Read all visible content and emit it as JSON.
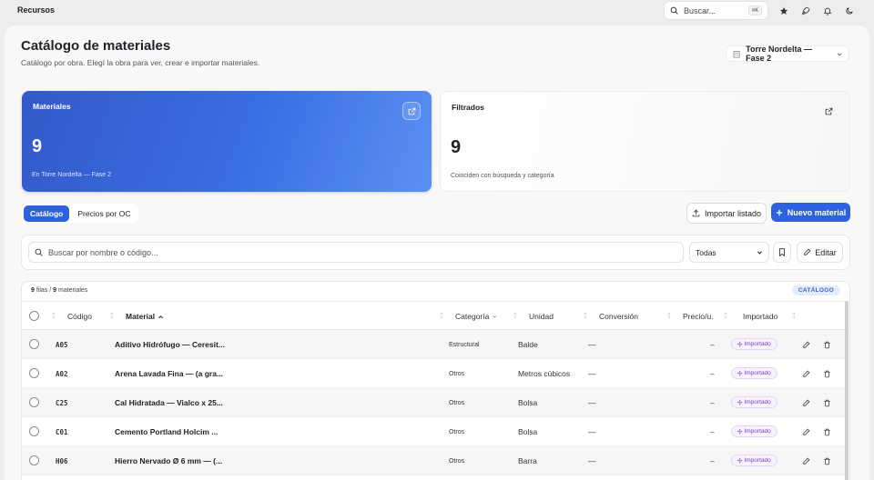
{
  "topbar": {
    "brand": "Recursos",
    "search_placeholder": "Buscar...",
    "search_shortcut": "⌘K",
    "icons": [
      "star-icon",
      "rocket-icon",
      "bell-icon",
      "moon-icon"
    ]
  },
  "header": {
    "title": "Catálogo de materiales",
    "subtitle": "Catálogo por obra. Elegí la obra para ver, crear e importar materiales.",
    "obra_selected": "Torre Nordelta — Fase 2"
  },
  "cards": {
    "materiales": {
      "title": "Materiales",
      "value": "9",
      "footer": "En Torre Nordelta — Fase 2"
    },
    "filtrados": {
      "title": "Filtrados",
      "value": "9",
      "footer": "Coinciden con búsqueda y categoría"
    }
  },
  "tabs": [
    {
      "label": "Catálogo",
      "active": true
    },
    {
      "label": "Precios por OC",
      "active": false
    }
  ],
  "actions": {
    "import_label": "Importar listado",
    "new_label": "Nuevo material"
  },
  "filters": {
    "search_placeholder": "Buscar por nombre o código...",
    "category_selected": "Todas",
    "edit_label": "Editar"
  },
  "table": {
    "meta_rows": "9",
    "meta_rows_label": "filas /",
    "meta_total": "9",
    "meta_total_label": "materiales",
    "badge": "CATÁLOGO",
    "columns": {
      "codigo": "Código",
      "material": "Material",
      "categoria": "Categoría",
      "unidad": "Unidad",
      "conversion": "Conversión",
      "precio": "Precio/u.",
      "importado": "Importado"
    },
    "rows": [
      {
        "codigo": "A05",
        "material": "Aditivo Hidrófugo — Ceresit...",
        "categoria": "Estructural",
        "unidad": "Balde",
        "conversion": "—",
        "precio": "–",
        "importado": "Importado"
      },
      {
        "codigo": "A02",
        "material": "Arena Lavada Fina — (a gra...",
        "categoria": "Otros",
        "unidad": "Metros cúbicos",
        "conversion": "—",
        "precio": "–",
        "importado": "Importado"
      },
      {
        "codigo": "C25",
        "material": "Cal Hidratada — Vialco x 25...",
        "categoria": "Otros",
        "unidad": "Bolsa",
        "conversion": "—",
        "precio": "–",
        "importado": "Importado"
      },
      {
        "codigo": "C01",
        "material": "Cemento Portland Holcim ...",
        "categoria": "Otros",
        "unidad": "Bolsa",
        "conversion": "—",
        "precio": "–",
        "importado": "Importado"
      },
      {
        "codigo": "H06",
        "material": "Hierro Nervado Ø 6 mm — (...",
        "categoria": "Otros",
        "unidad": "Barra",
        "conversion": "—",
        "precio": "–",
        "importado": "Importado"
      }
    ]
  },
  "colors": {
    "accent": "#2c62e0",
    "card_gradient_start": "#3459c8",
    "card_gradient_end": "#5b91f2",
    "imported_badge": "#7a3fc6"
  }
}
